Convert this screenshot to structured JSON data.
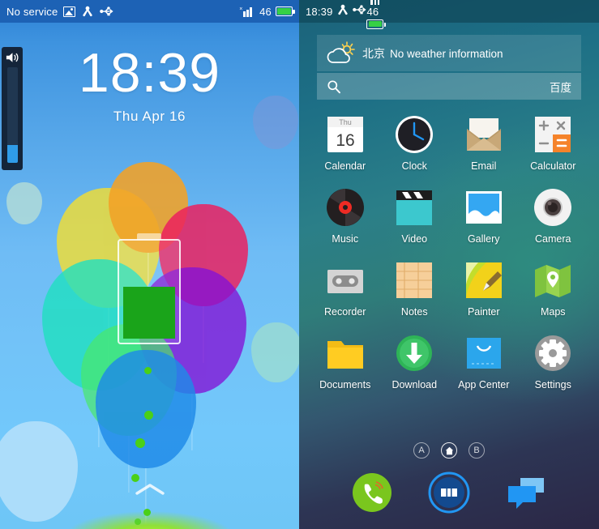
{
  "lock_screen": {
    "status_bar": {
      "carrier": "No service",
      "icons": [
        "screenshot-icon",
        "adb-icon",
        "usb-icon"
      ],
      "signal_icon": "signal-bars-icon",
      "battery_percent": "46",
      "battery_icon": "battery-icon"
    },
    "clock": {
      "time": "18:39",
      "date": "Thu Apr 16"
    },
    "volume_slider": {
      "icon": "speaker-icon",
      "level_percent": 18
    },
    "battery_widget": {
      "name": "battery-overlay",
      "fill_color": "#1aa41a"
    },
    "unlock_hint": "chevron-up-icon",
    "balloon_colors": [
      "#f2a227",
      "#f5de2e",
      "#ec1f5e",
      "#1fe0c0",
      "#8312d6",
      "#49e86a",
      "#1e8ae8"
    ]
  },
  "home_screen": {
    "status_bar": {
      "time": "18:39",
      "icons": [
        "adb-icon",
        "usb-icon"
      ],
      "signal_icon": "signal-bars-icon",
      "battery_percent": "46",
      "battery_icon": "battery-icon"
    },
    "weather_widget": {
      "icon": "sun-cloud-icon",
      "city": "北京",
      "description": "No weather information"
    },
    "search": {
      "icon": "search-icon",
      "value": "",
      "placeholder": "",
      "engine": "百度"
    },
    "apps": [
      {
        "label": "Calendar",
        "icon": "calendar-icon",
        "day_name": "Thu",
        "day_number": "16"
      },
      {
        "label": "Clock",
        "icon": "clock-icon"
      },
      {
        "label": "Email",
        "icon": "email-icon"
      },
      {
        "label": "Calculator",
        "icon": "calculator-icon",
        "keys": [
          "+",
          "×",
          "−",
          "="
        ]
      },
      {
        "label": "Music",
        "icon": "music-icon"
      },
      {
        "label": "Video",
        "icon": "video-icon"
      },
      {
        "label": "Gallery",
        "icon": "gallery-icon"
      },
      {
        "label": "Camera",
        "icon": "camera-icon"
      },
      {
        "label": "Recorder",
        "icon": "recorder-icon"
      },
      {
        "label": "Notes",
        "icon": "notes-icon"
      },
      {
        "label": "Painter",
        "icon": "painter-icon"
      },
      {
        "label": "Maps",
        "icon": "maps-icon"
      },
      {
        "label": "Documents",
        "icon": "documents-icon"
      },
      {
        "label": "Download",
        "icon": "download-icon"
      },
      {
        "label": "App Center",
        "icon": "app-center-icon"
      },
      {
        "label": "Settings",
        "icon": "settings-gear-icon"
      }
    ],
    "page_indicators": [
      {
        "label": "A",
        "icon": "",
        "active": false
      },
      {
        "label": "",
        "icon": "home-icon",
        "active": true
      },
      {
        "label": "B",
        "icon": "",
        "active": false
      }
    ],
    "dock": [
      {
        "name": "phone",
        "icon": "phone-icon",
        "color": "#7ac61e"
      },
      {
        "name": "contacts",
        "icon": "contacts-icon",
        "color": "#1565c0"
      },
      {
        "name": "messaging",
        "icon": "message-bubbles-icon",
        "color": "#2196f3"
      }
    ]
  }
}
